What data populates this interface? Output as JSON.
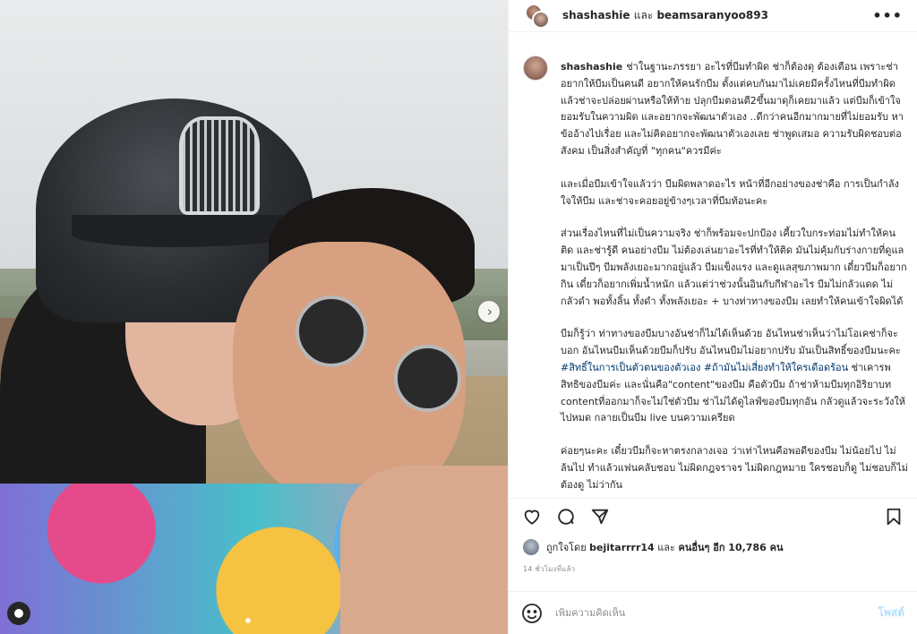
{
  "photo": {
    "next_icon": "chevron-right-icon",
    "user_tag_icon": "user-icon"
  },
  "header": {
    "user1": "shashashie",
    "and": "และ",
    "user2": "beamsaranyoo893",
    "more_icon": "..."
  },
  "caption": {
    "username": "shashashie",
    "p1": "ช่าในฐานะภรรยา อะไรที่บีมทำผิด ช่าก็ต้องดุ ต้องเตือน เพราะช่าอยากให้บีมเป็นคนดี อยากให้คนรักบีม ตั้งแต่คบกันมาไม่เคยมีครั้งไหนที่บีมทำผิดแล้วช่าจะปล่อยผ่านหรือให้ท้าย ปลุกบีมตอนตี2ขึ้นมาดุก็เคยมาแล้ว แต่บีมก็เข้าใจ ยอมรับในความผิด และอยากจะพัฒนาตัวเอง ..ดีกว่าคนอีกมากมายที่ไม่ยอมรับ หาข้ออ้างไปเรื่อย และไม่คิดอยากจะพัฒนาตัวเองเลย ช่าพูดเสมอ ความรับผิดชอบต่อสังคม เป็นสิ่งสำคัญที่ \"ทุกคน\"ควรมีค่ะ",
    "p2": "และเมื่อบีมเข้าใจแล้วว่า บีมผิดพลาดอะไร หน้าที่อีกอย่างของช่าคือ การเป็นกำลังใจให้บีม และช่าจะคอยอยู่ข้างๆเวลาที่บีมท้อนะคะ",
    "p3": "ส่วนเรื่องไหนที่ไม่เป็นความจริง ช่าก็พร้อมจะปกป้อง เคี้ยวใบกระท่อมไม่ทำให้คนติด และช่ารู้ดี คนอย่างบีม ไม่ต้องเล่นยาอะไรที่ทำให้ติด มันไม่คุ้มกับร่างกายที่ดูแลมาเป็นปีๆ บีมพลังเยอะมากอยู่แล้ว บีมแข็งแรง และดูแลสุขภาพมาก เดี๋ยวบีมก็อยากกิน เดี๋ยวก็อยากเพิ่มน้ำหนัก แล้วแต่ว่าช่วงนั้นอินกับกีฬาอะไร บีมไม่กลัวแดด ไม่กลัวดำ พอทั้งลิ้น ทั้งดำ ทั้งพลังเยอะ + บางท่าทางของบีม เลยทำให้คนเข้าใจผิดได้",
    "p4_a": "บีมก็รู้ว่า ท่าทางของบีมบางอันช่าก็ไม่ได้เห็นด้วย อันไหนช่าเห็นว่าไม่โอเคช่าก็จะบอก อันไหนบีมเห็นด้วยบีมก็ปรับ อันไหนบีมไม่อยากปรับ มันเป็นสิทธิ์ของบีมนะคะ ",
    "p4_hash1": "#สิทธิ์ในการเป็นตัวตนของตัวเอง",
    "p4_space": " ",
    "p4_hash2": "#ถ้ามันไม่เสี่ยงทำให้ใครเดือดร้อน",
    "p4_b": " ช่าเคารพสิทธิของบีมค่ะ และนั่นคือ\"content\"ของบีม คือตัวบีม ถ้าช่าห้ามบีมทุกอิริยาบท contentที่ออกมาก็จะไม่ใช่ตัวบีม ช่าไม่ได้ดูไลฟ์ของบีมทุกอัน กลัวดูแล้วจะระวังให้ไปหมด กลายเป็นบีม live บนความเครียด",
    "p5": "ค่อยๆนะคะ เดี๋ยวบีมก็จะหาตรงกลางเจอ ว่าเท่าไหนคือพอดีของบีม ไม่น้อยไป ไม่ล้นไป ทำแล้วแฟนคลับชอบ ไม่ผิดกฎจราจร ไม่ผิดกฎหมาย ใครชอบก็ดู ไม่ชอบก็ไม่ต้องดู ไม่ว่ากัน"
  },
  "actions": {
    "like_icon": "heart-icon",
    "comment_icon": "comment-icon",
    "share_icon": "send-icon",
    "save_icon": "bookmark-icon"
  },
  "likes": {
    "prefix": "ถูกใจโดย",
    "user": "bejitarrrr14",
    "mid": "และ",
    "others": "คนอื่นๆ อีก 10,786 คน"
  },
  "time": "14 ชั่วโมงที่แล้ว",
  "comment": {
    "placeholder": "เพิ่มความคิดเห็น",
    "post_label": "โพสต์",
    "emoji_icon": "emoji-icon"
  }
}
